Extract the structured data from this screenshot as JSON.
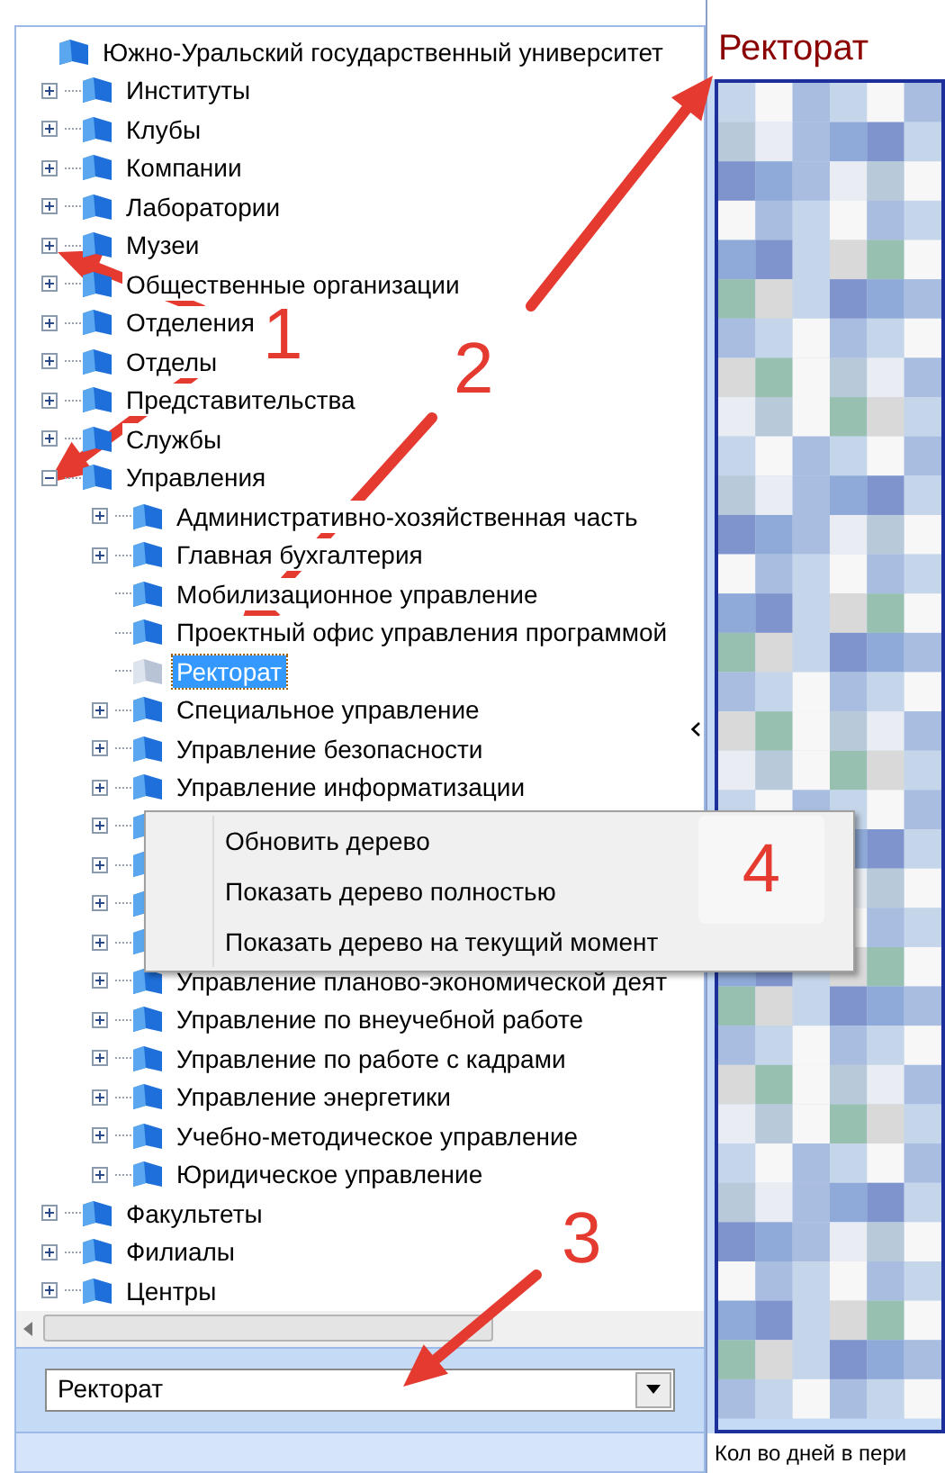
{
  "tree": {
    "label": "Южно-Уральский государственный университет",
    "kind": "root",
    "selected": false,
    "children": [
      {
        "label": "Институты",
        "kind": "branch",
        "expanded": false,
        "selected": false
      },
      {
        "label": "Клубы",
        "kind": "branch",
        "expanded": false,
        "selected": false
      },
      {
        "label": "Компании",
        "kind": "branch",
        "expanded": false,
        "selected": false
      },
      {
        "label": "Лаборатории",
        "kind": "branch",
        "expanded": false,
        "selected": false
      },
      {
        "label": "Музеи",
        "kind": "branch",
        "expanded": false,
        "selected": false
      },
      {
        "label": "Общественные организации",
        "kind": "branch",
        "expanded": false,
        "selected": false
      },
      {
        "label": "Отделения",
        "kind": "branch",
        "expanded": false,
        "selected": false
      },
      {
        "label": "Отделы",
        "kind": "branch",
        "expanded": false,
        "selected": false
      },
      {
        "label": "Представительства",
        "kind": "branch",
        "expanded": false,
        "selected": false
      },
      {
        "label": "Службы",
        "kind": "branch",
        "expanded": false,
        "selected": false
      },
      {
        "label": "Управления",
        "kind": "branch",
        "expanded": true,
        "selected": false,
        "children": [
          {
            "label": "Административно-хозяйственная часть",
            "kind": "branch",
            "expanded": false,
            "selected": false
          },
          {
            "label": "Главная бухгалтерия",
            "kind": "branch",
            "expanded": false,
            "selected": false
          },
          {
            "label": "Мобилизационное управление",
            "kind": "leaf",
            "selected": false
          },
          {
            "label": "Проектный офис управления программой",
            "kind": "leaf",
            "selected": false
          },
          {
            "label": "Ректорат",
            "kind": "leaf",
            "selected": true
          },
          {
            "label": "Специальное управление",
            "kind": "branch",
            "expanded": false,
            "selected": false
          },
          {
            "label": "Управление безопасности",
            "kind": "branch",
            "expanded": false,
            "selected": false
          },
          {
            "label": "Управление информатизации",
            "kind": "branch",
            "expanded": false,
            "selected": false
          },
          {
            "kind": "branch",
            "expanded": false,
            "selected": false
          },
          {
            "kind": "branch",
            "expanded": false,
            "selected": false
          },
          {
            "kind": "branch",
            "expanded": false,
            "selected": false
          },
          {
            "kind": "branch",
            "expanded": false,
            "selected": false
          },
          {
            "label": "Управление планово-экономической деят",
            "kind": "branch",
            "expanded": false,
            "selected": false
          },
          {
            "label": "Управление по внеучебной работе",
            "kind": "branch",
            "expanded": false,
            "selected": false
          },
          {
            "label": "Управление по работе с кадрами",
            "kind": "branch",
            "expanded": false,
            "selected": false
          },
          {
            "label": "Управление энергетики",
            "kind": "branch",
            "expanded": false,
            "selected": false
          },
          {
            "label": "Учебно-методическое управление",
            "kind": "branch",
            "expanded": false,
            "selected": false
          },
          {
            "label": "Юридическое управление",
            "kind": "branch",
            "expanded": false,
            "selected": false
          }
        ]
      },
      {
        "label": "Факультеты",
        "kind": "branch",
        "expanded": false,
        "selected": false
      },
      {
        "label": "Филиалы",
        "kind": "branch",
        "expanded": false,
        "selected": false
      },
      {
        "label": "Центры",
        "kind": "branch",
        "expanded": false,
        "selected": false
      }
    ]
  },
  "context_menu": [
    "Обновить дерево",
    "Показать дерево полностью",
    "Показать дерево на текущий момент"
  ],
  "combo": {
    "value": "Ректорат"
  },
  "detail": {
    "title": "Ректорат",
    "footer": "Кол во дней в пери"
  },
  "annotations": [
    "1",
    "2",
    "3",
    "4"
  ]
}
